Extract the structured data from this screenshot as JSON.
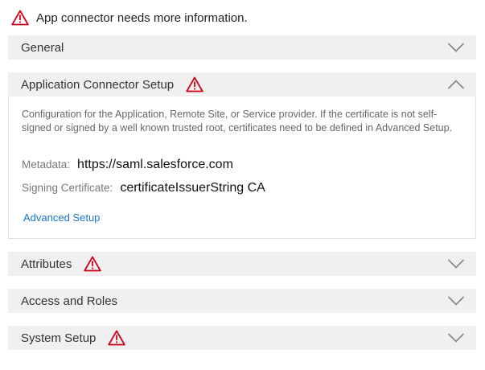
{
  "notice": {
    "text": "App connector needs more information.",
    "icon": "warning-icon"
  },
  "sections": {
    "general": {
      "title": "General",
      "expanded": false,
      "warning": false
    },
    "connector_setup": {
      "title": "Application Connector Setup",
      "expanded": true,
      "warning": true,
      "description": "Configuration for the Application, Remote Site, or Service provider. If the certificate is not self-signed or signed by a well known trusted root, certificates need to be defined in Advanced Setup.",
      "metadata_label": "Metadata:",
      "metadata_value": "https://saml.salesforce.com",
      "signing_label": "Signing Certificate:",
      "signing_value": "certificateIssuerString CA",
      "advanced_link": "Advanced Setup"
    },
    "attributes": {
      "title": "Attributes",
      "expanded": false,
      "warning": true
    },
    "access_roles": {
      "title": "Access and Roles",
      "expanded": false,
      "warning": false
    },
    "system_setup": {
      "title": "System Setup",
      "expanded": false,
      "warning": true
    }
  },
  "colors": {
    "warning": "#d0021b",
    "header_bg": "#f0f0f0",
    "link": "#1a73c8",
    "chevron": "#888888"
  }
}
